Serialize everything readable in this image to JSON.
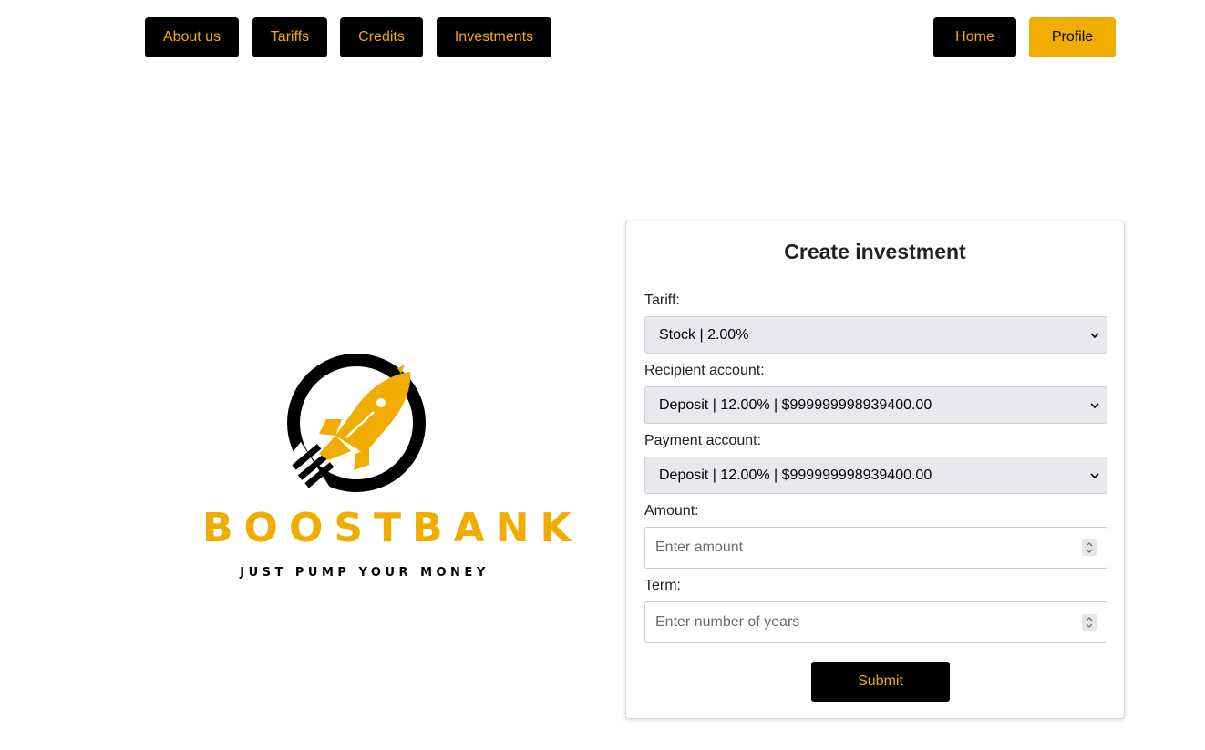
{
  "nav": {
    "about_label": "About us",
    "tariffs_label": "Tariffs",
    "credits_label": "Credits",
    "investments_label": "Investments",
    "home_label": "Home",
    "profile_label": "Profile"
  },
  "brand": {
    "name": "BOOSTBANK",
    "tagline": "JUST PUMP YOUR MONEY",
    "logo_icon": "rocket-icon"
  },
  "form": {
    "title": "Create investment",
    "tariff_label": "Tariff:",
    "tariff_value": "Stock | 2.00%",
    "recipient_label": "Recipient account:",
    "recipient_value": "Deposit | 12.00% | $999999998939400.00",
    "payment_label": "Payment account:",
    "payment_value": "Deposit | 12.00% | $999999998939400.00",
    "amount_label": "Amount:",
    "amount_placeholder": "Enter amount",
    "term_label": "Term:",
    "term_placeholder": "Enter number of years",
    "submit_label": "Submit"
  },
  "colors": {
    "accent": "#f0ad00",
    "dark": "#000000"
  }
}
